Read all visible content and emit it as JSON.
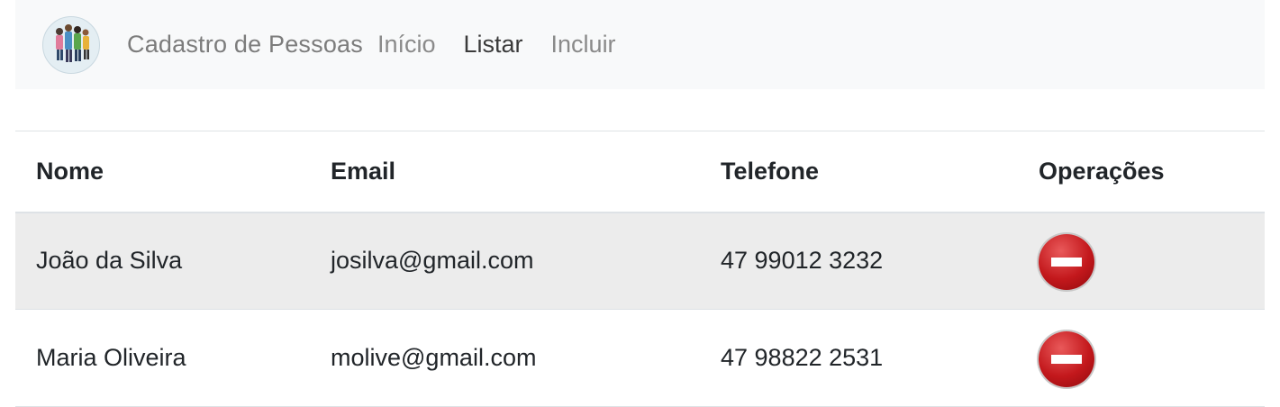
{
  "navbar": {
    "brand": "Cadastro de Pessoas",
    "links": [
      "Início",
      "Listar",
      "Incluir"
    ],
    "active": "Listar"
  },
  "table": {
    "headers": [
      "Nome",
      "Email",
      "Telefone",
      "Operações"
    ],
    "rows": [
      {
        "nome": "João da Silva",
        "email": "josilva@gmail.com",
        "telefone": "47 99012 3232",
        "operacao": "remove-icon"
      },
      {
        "nome": "Maria Oliveira",
        "email": "molive@gmail.com",
        "telefone": "47 98822 2531",
        "operacao": "remove-icon"
      }
    ]
  },
  "colors": {
    "navbar_bg": "#f8f9fa",
    "striped_row": "#ececec",
    "delete_red": "#c3181c"
  }
}
